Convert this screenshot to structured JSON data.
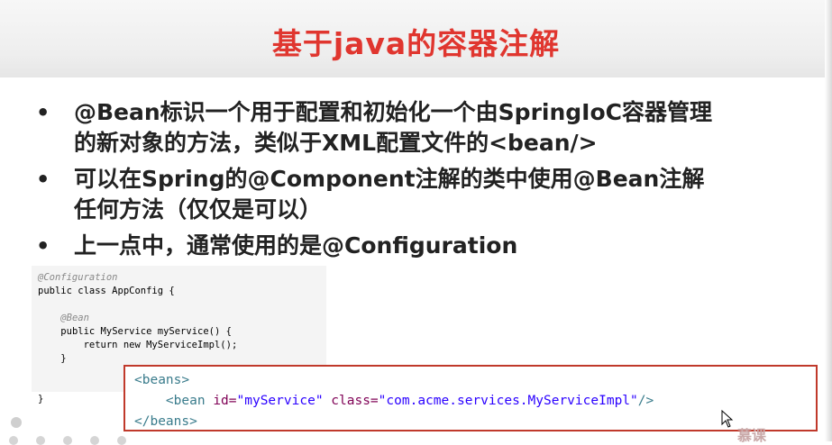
{
  "slide": {
    "title": "基于java的容器注解",
    "bullets": [
      {
        "line1": "@Bean标识一个用于配置和初始化一个由SpringIoC容器管理",
        "line2": "的新对象的方法，类似于XML配置文件的<bean/>"
      },
      {
        "line1": "可以在Spring的@Component注解的类中使用@Bean注解",
        "line2": "任何方法（仅仅是可以）"
      },
      {
        "line1": "上一点中，通常使用的是@Configuration",
        "line2": ""
      }
    ],
    "bullet_symbol": "•"
  },
  "java_code": {
    "annotation_config": "@Configuration",
    "class_decl": "public class AppConfig {",
    "annotation_bean": "@Bean",
    "method_decl": "public MyService myService() {",
    "return_stmt": "return new MyServiceImpl();",
    "method_close": "}",
    "class_close": "}"
  },
  "xml_code": {
    "open_tag": "<beans>",
    "bean_tag_start": "<bean ",
    "id_attr": "id=",
    "id_value": "\"myService\"",
    "class_attr": "class=",
    "class_value": "\"com.acme.services.MyServiceImpl\"",
    "bean_tag_end": "/>",
    "close_tag": "</beans>"
  },
  "watermark": "慕课"
}
